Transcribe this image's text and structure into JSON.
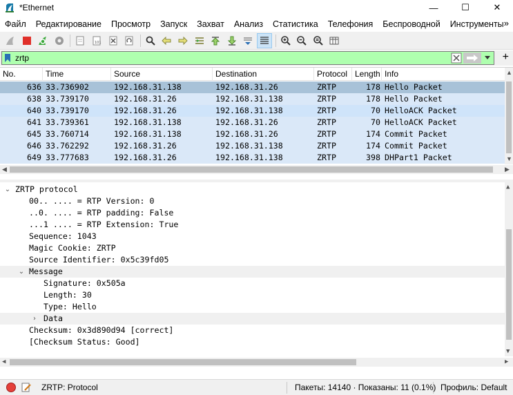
{
  "window": {
    "title": "*Ethernet",
    "minimize": "—",
    "maximize": "☐",
    "close": "✕"
  },
  "menu": {
    "items": [
      "Файл",
      "Редактирование",
      "Просмотр",
      "Запуск",
      "Захват",
      "Анализ",
      "Статистика",
      "Телефония",
      "Беспроводной",
      "Инструменты"
    ],
    "more": "»"
  },
  "toolbar": {
    "icons": [
      "shark-fin-start-icon",
      "stop-square-icon",
      "restart-capture-icon",
      "capture-options-gear-icon",
      "open-file-icon",
      "save-file-icon",
      "close-file-icon",
      "reload-file-icon",
      "find-packet-icon",
      "go-back-arrow-icon",
      "go-forward-arrow-icon",
      "go-to-packet-icon",
      "go-first-packet-icon",
      "go-last-packet-icon",
      "autoscroll-icon",
      "colorize-list-icon",
      "zoom-in-icon",
      "zoom-out-icon",
      "zoom-normal-icon",
      "resize-columns-icon"
    ]
  },
  "filter": {
    "value": "zrtp",
    "plus": "+"
  },
  "packet_list": {
    "columns": [
      "No.",
      "Time",
      "Source",
      "Destination",
      "Protocol",
      "Length",
      "Info"
    ],
    "rows": [
      {
        "no": "636",
        "time": "33.736902",
        "src": "192.168.31.138",
        "dst": "192.168.31.26",
        "proto": "ZRTP",
        "len": "178",
        "info": "Hello Packet"
      },
      {
        "no": "638",
        "time": "33.739170",
        "src": "192.168.31.26",
        "dst": "192.168.31.138",
        "proto": "ZRTP",
        "len": "178",
        "info": "Hello Packet"
      },
      {
        "no": "640",
        "time": "33.739170",
        "src": "192.168.31.26",
        "dst": "192.168.31.138",
        "proto": "ZRTP",
        "len": "70",
        "info": "HelloACK Packet"
      },
      {
        "no": "641",
        "time": "33.739361",
        "src": "192.168.31.138",
        "dst": "192.168.31.26",
        "proto": "ZRTP",
        "len": "70",
        "info": "HelloACK Packet"
      },
      {
        "no": "645",
        "time": "33.760714",
        "src": "192.168.31.138",
        "dst": "192.168.31.26",
        "proto": "ZRTP",
        "len": "174",
        "info": "Commit Packet"
      },
      {
        "no": "646",
        "time": "33.762292",
        "src": "192.168.31.26",
        "dst": "192.168.31.138",
        "proto": "ZRTP",
        "len": "174",
        "info": "Commit Packet"
      },
      {
        "no": "649",
        "time": "33.777683",
        "src": "192.168.31.26",
        "dst": "192.168.31.138",
        "proto": "ZRTP",
        "len": "398",
        "info": "DHPart1 Packet"
      }
    ]
  },
  "details": {
    "lines": [
      {
        "text": "ZRTP protocol",
        "twisty": "⌄"
      },
      {
        "text": "00.. .... = RTP Version: 0",
        "twisty": ""
      },
      {
        "text": "..0. .... = RTP padding: False",
        "twisty": ""
      },
      {
        "text": "...1 .... = RTP Extension: True",
        "twisty": ""
      },
      {
        "text": "Sequence: 1043",
        "twisty": ""
      },
      {
        "text": "Magic Cookie: ZRTP",
        "twisty": ""
      },
      {
        "text": "Source Identifier: 0x5c39fd05",
        "twisty": ""
      },
      {
        "text": "Message",
        "twisty": "⌄"
      },
      {
        "text": "Signature: 0x505a",
        "twisty": ""
      },
      {
        "text": "Length: 30",
        "twisty": ""
      },
      {
        "text": "Type: Hello",
        "twisty": ""
      },
      {
        "text": "Data",
        "twisty": "›"
      },
      {
        "text": "Checksum: 0x3d890d94 [correct]",
        "twisty": ""
      },
      {
        "text": "[Checksum Status: Good]",
        "twisty": ""
      }
    ]
  },
  "status": {
    "selected": "ZRTP: Protocol",
    "packets": "Пакеты: 14140 · Показаны: 11 (0.1%)",
    "profile": "Профиль: Default"
  },
  "colors": {
    "filter_ok": "#afffaf",
    "row": "#dae8f8",
    "row_selected": "#a8c2d8"
  }
}
